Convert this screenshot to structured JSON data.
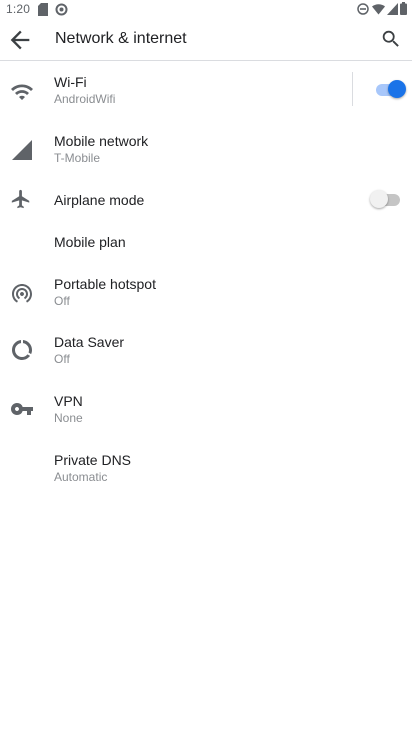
{
  "status_bar": {
    "time": "1:20",
    "left_icons": [
      "sd-card-icon",
      "sync-icon"
    ],
    "right_icons": [
      "do-not-disturb-icon",
      "wifi-icon",
      "signal-icon",
      "battery-icon"
    ]
  },
  "app_bar": {
    "title": "Network & internet",
    "back_icon": "arrow-back-icon",
    "search_icon": "search-icon"
  },
  "items": [
    {
      "icon": "wifi-icon",
      "title": "Wi-Fi",
      "subtitle": "AndroidWifi",
      "toggle": true
    },
    {
      "icon": "cellular-signal-icon",
      "title": "Mobile network",
      "subtitle": "T-Mobile"
    },
    {
      "icon": "airplane-icon",
      "title": "Airplane mode",
      "subtitle": "",
      "toggle": false
    },
    {
      "icon": "",
      "title": "Mobile plan",
      "subtitle": ""
    },
    {
      "icon": "hotspot-icon",
      "title": "Portable hotspot",
      "subtitle": "Off"
    },
    {
      "icon": "data-saver-icon",
      "title": "Data Saver",
      "subtitle": "Off"
    },
    {
      "icon": "vpn-key-icon",
      "title": "VPN",
      "subtitle": "None"
    },
    {
      "icon": "",
      "title": "Private DNS",
      "subtitle": "Automatic"
    }
  ],
  "colors": {
    "accent": "#1a73e8",
    "icon": "#5f6368",
    "text_primary": "#202124",
    "text_secondary": "#8a8d91"
  }
}
